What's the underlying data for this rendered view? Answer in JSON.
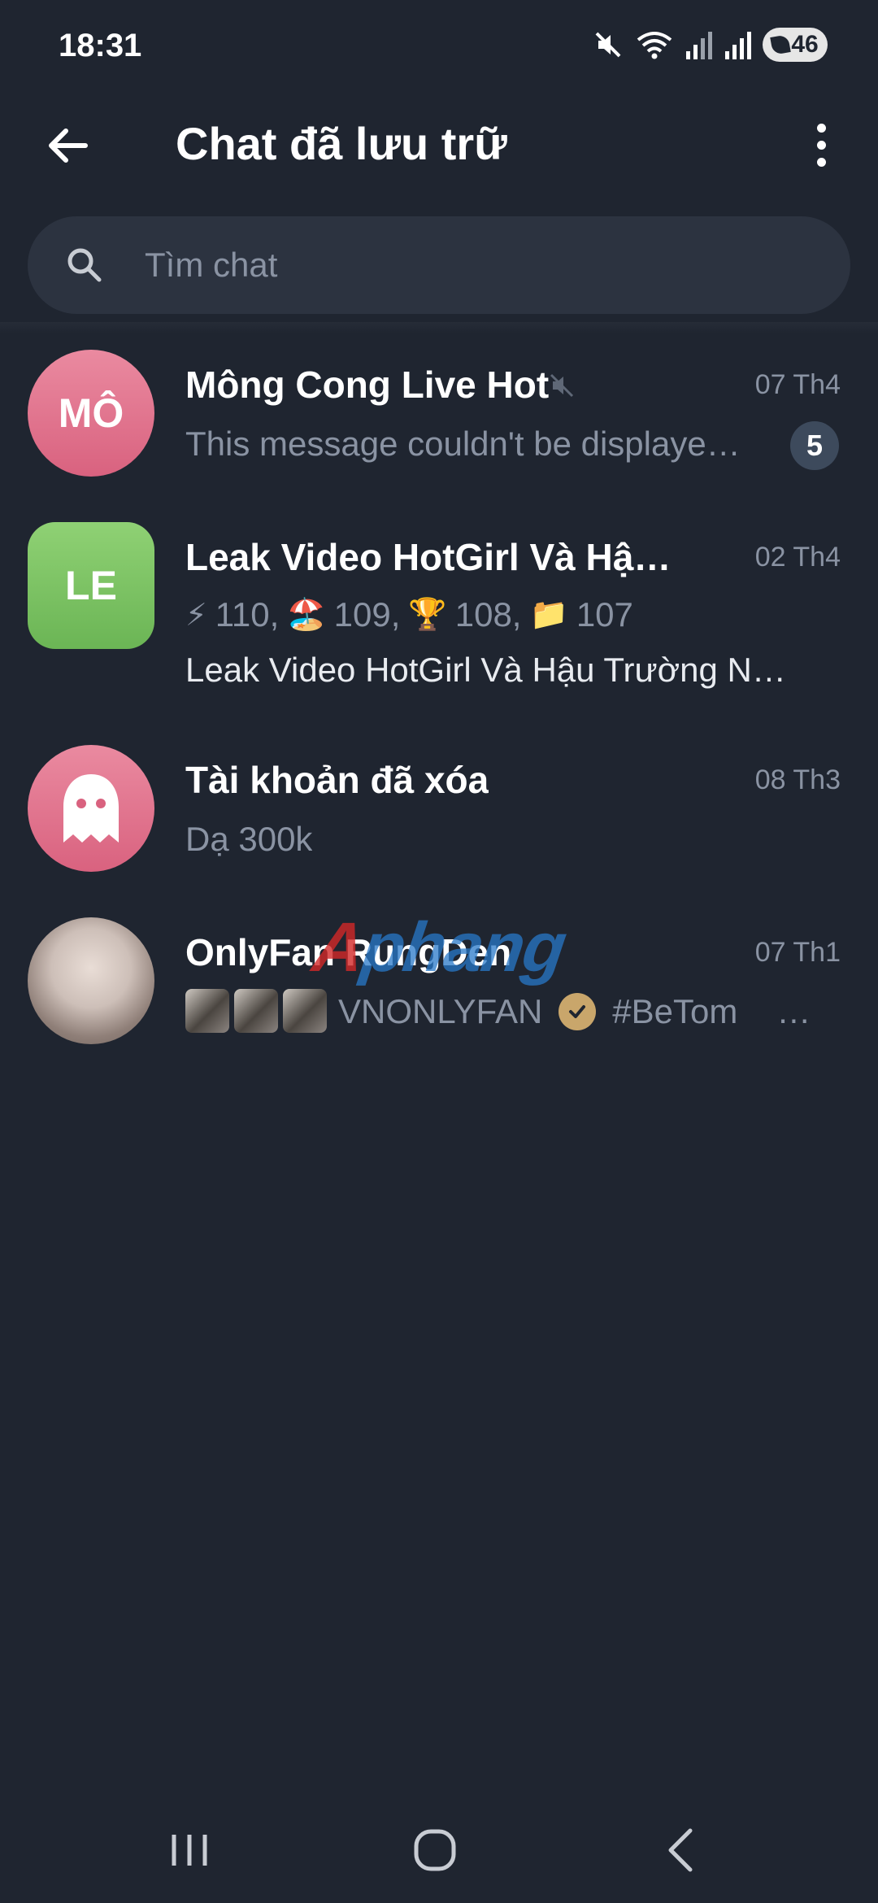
{
  "status_bar": {
    "time": "18:31",
    "battery": "46"
  },
  "header": {
    "title": "Chat đã lưu trữ"
  },
  "search": {
    "placeholder": "Tìm chat"
  },
  "chats": [
    {
      "avatar_text": "MÔ",
      "avatar_color": "#e37a93",
      "name": "Mông Cong Live Hot",
      "muted": true,
      "date": "07 Th4",
      "message": "This message couldn't be displaye…",
      "unread": "5"
    },
    {
      "avatar_text": "LE",
      "avatar_color": "#7cc465",
      "name": "Leak Video HotGirl Và Hậu…",
      "date": "02 Th4",
      "reactions": [
        {
          "emoji": "⚡",
          "count": "110,"
        },
        {
          "emoji": "🏖️",
          "count": "109,"
        },
        {
          "emoji": "🏆",
          "count": "108,"
        },
        {
          "emoji": "📁",
          "count": "107"
        }
      ],
      "message": "Leak Video HotGirl Và Hậu Trường N…"
    },
    {
      "avatar_icon": "ghost-icon",
      "avatar_color": "#e37a93",
      "name": "Tài khoản đã xóa",
      "date": "08 Th3",
      "message": "Dạ 300k"
    },
    {
      "avatar_image": "photo",
      "name": "OnlyFan RungDen",
      "date": "07 Th1",
      "message_prefix": "VNONLYFAN",
      "message_suffix": "#BeTom",
      "message_ellipsis": "…"
    }
  ],
  "watermark": {
    "first": "A",
    "rest": "phang"
  },
  "colors": {
    "background": "#1f2530",
    "search_bg": "#2c3340",
    "secondary_text": "#8a93a3",
    "badge": "#3d4a5c"
  }
}
